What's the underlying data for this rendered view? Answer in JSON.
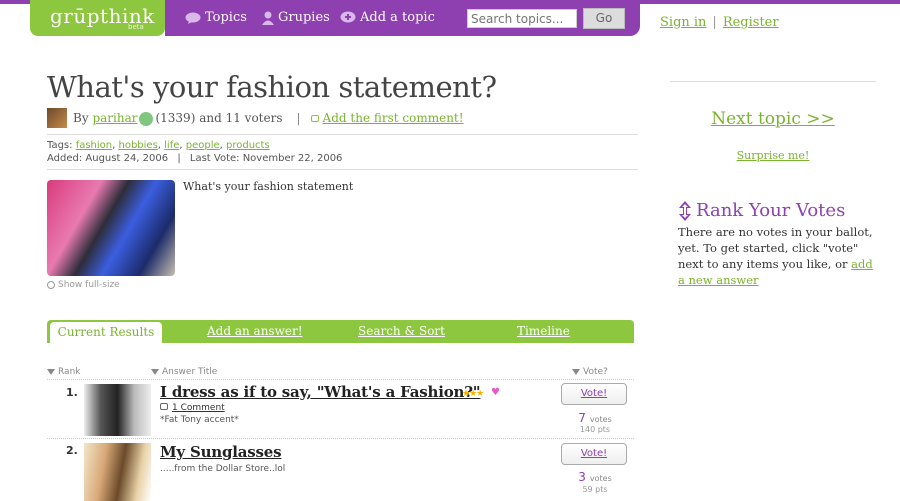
{
  "header": {
    "logo": "grūpthink",
    "logo_badge": "beta",
    "nav": [
      "Topics",
      "Grupies",
      "Add a topic"
    ],
    "search_placeholder": "Search topics...",
    "go_label": "Go"
  },
  "auth": {
    "sign_in": "Sign in",
    "separator": "|",
    "register": "Register"
  },
  "topic": {
    "title": "What's your fashion statement?",
    "by": "By",
    "author": "parihar",
    "author_score": "(1339)",
    "voters": "and 11 voters",
    "bar": "|",
    "first_comment": "Add the first comment!",
    "tags_label": "Tags:",
    "tags": [
      "fashion",
      "hobbies",
      "life",
      "people",
      "products"
    ],
    "added": "Added: August 24, 2006",
    "last_vote": "Last Vote: November 22, 2006",
    "meta_bar": "|",
    "description": "What's your fashion statement",
    "show_full": "Show full-size"
  },
  "tabs": [
    "Current Results",
    "Add an answer!",
    "Search & Sort",
    "Timeline"
  ],
  "columns": {
    "rank": "Rank",
    "answer": "Answer Title",
    "vote": "Vote?"
  },
  "answers": [
    {
      "rank": "1.",
      "title": "I dress as if to say, \"What's a Fashion?\"",
      "comments": "1 Comment",
      "subtitle": "*Fat Tony accent*",
      "vote_label": "Vote!",
      "votes": "7",
      "votes_unit": "votes",
      "points": "140 pts",
      "stars": "★★★",
      "heart": "♥"
    },
    {
      "rank": "2.",
      "title": "My Sunglasses",
      "subtitle": ".....from the Dollar Store..lol",
      "vote_label": "Vote!",
      "votes": "3",
      "votes_unit": "votes",
      "points": "59 pts"
    }
  ],
  "sidebar": {
    "next_topic": "Next topic >>",
    "surprise": "Surprise me!",
    "rank_title": "Rank Your Votes",
    "rank_text": "There are no votes in your ballot, yet. To get started, click \"vote\" next to any items you like, or",
    "rank_link": "add a new answer"
  },
  "colors": {
    "green": "#8dc63f",
    "purple": "#8e3fb0"
  }
}
